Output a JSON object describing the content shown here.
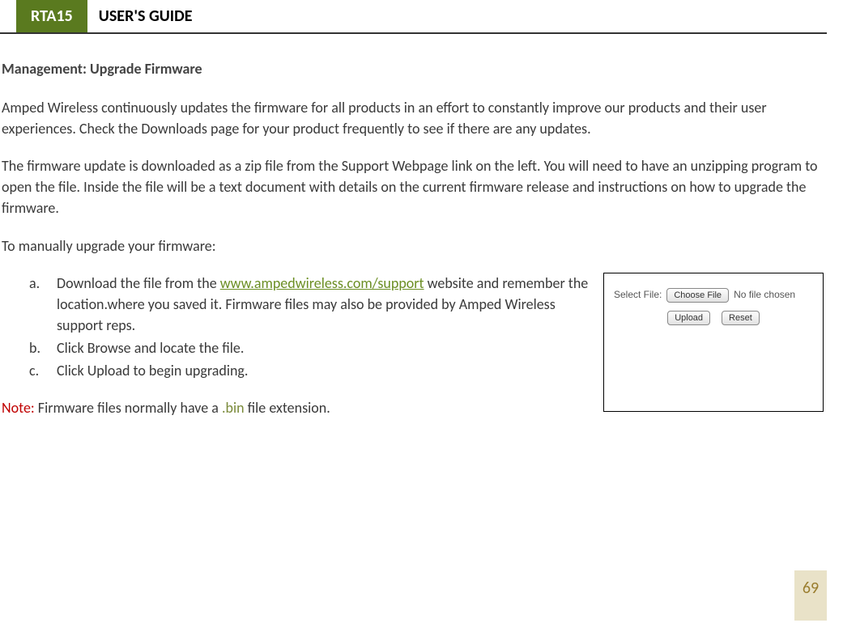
{
  "header": {
    "badge": "RTA15",
    "title": "USER'S GUIDE"
  },
  "section_title": "Management: Upgrade Firmware",
  "para1": "Amped Wireless continuously updates the firmware for all products in an effort to constantly improve our products and their user experiences.  Check the Downloads page for your product frequently to see if there are any updates.",
  "para2": "The firmware update is downloaded as a zip file from the Support Webpage link on the left.  You will need to have an unzipping program to open the file.  Inside the file will be a text document with details on the current firmware release and instructions on how to upgrade the firmware.",
  "para3": "To manually upgrade your firmware:",
  "list": {
    "a": {
      "marker": "a.",
      "pre": "Download the file from the ",
      "link": "www.ampedwireless.com/support",
      "post": " website and remember the location.where you saved it.  Firmware files may also be provided by Amped Wireless support reps."
    },
    "b": {
      "marker": "b.",
      "text": "Click Browse and locate the file."
    },
    "c": {
      "marker": "c.",
      "text": "Click Upload to begin upgrading."
    }
  },
  "note": {
    "prefix": "Note:",
    "mid": " Firmware files normally have a ",
    "ext": ".bin",
    "post": " file extension."
  },
  "figure": {
    "select_label": "Select File:",
    "choose_btn": "Choose File",
    "no_file": "No file chosen",
    "upload_btn": "Upload",
    "reset_btn": "Reset"
  },
  "page_number": "69"
}
